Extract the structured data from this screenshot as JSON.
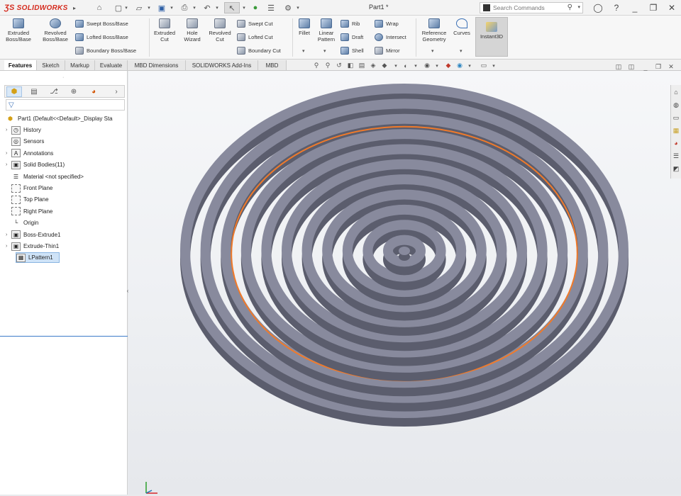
{
  "app": {
    "brand": "SOLIDWORKS",
    "document_title": "Part1 *",
    "search_placeholder": "Search Commands"
  },
  "ribbon": {
    "extrude_group": [
      {
        "label": "Extruded\nBoss/Base",
        "icon": "extruded-boss-icon"
      },
      {
        "label": "Revolved\nBoss/Base",
        "icon": "revolved-boss-icon"
      }
    ],
    "boss_small": [
      "Swept Boss/Base",
      "Lofted Boss/Base",
      "Boundary Boss/Base"
    ],
    "cut_group": [
      {
        "label": "Extruded\nCut",
        "icon": "extruded-cut-icon"
      },
      {
        "label": "Hole\nWizard",
        "icon": "hole-wizard-icon"
      },
      {
        "label": "Revolved\nCut",
        "icon": "revolved-cut-icon"
      }
    ],
    "cut_small": [
      "Swept Cut",
      "Lofted Cut",
      "Boundary Cut"
    ],
    "features": [
      {
        "label": "Fillet",
        "icon": "fillet-icon"
      },
      {
        "label": "Linear\nPattern",
        "icon": "linear-pattern-icon"
      }
    ],
    "features_small_a": [
      "Rib",
      "Draft",
      "Shell"
    ],
    "features_small_b": [
      "Wrap",
      "Intersect",
      "Mirror"
    ],
    "ref": [
      {
        "label": "Reference\nGeometry",
        "icon": "reference-geometry-icon"
      },
      {
        "label": "Curves",
        "icon": "curves-icon"
      },
      {
        "label": "Instant3D",
        "icon": "instant3d-icon"
      }
    ]
  },
  "tabs": [
    "Features",
    "Sketch",
    "Markup",
    "Evaluate",
    "MBD Dimensions",
    "SOLIDWORKS Add-Ins",
    "MBD"
  ],
  "active_tab": "Features",
  "tree": {
    "root": "Part1  (Default<<Default>_Display Sta",
    "items": [
      {
        "label": "History",
        "expandable": true,
        "icon": "history-icon"
      },
      {
        "label": "Sensors",
        "expandable": false,
        "icon": "sensors-icon"
      },
      {
        "label": "Annotations",
        "expandable": true,
        "icon": "annotations-icon"
      },
      {
        "label": "Solid Bodies(11)",
        "expandable": true,
        "icon": "solid-bodies-icon"
      },
      {
        "label": "Material <not specified>",
        "expandable": false,
        "icon": "material-icon"
      },
      {
        "label": "Front Plane",
        "expandable": false,
        "icon": "plane-icon"
      },
      {
        "label": "Top Plane",
        "expandable": false,
        "icon": "plane-icon"
      },
      {
        "label": "Right Plane",
        "expandable": false,
        "icon": "plane-icon"
      },
      {
        "label": "Origin",
        "expandable": false,
        "icon": "origin-icon"
      },
      {
        "label": "Boss-Extrude1",
        "expandable": true,
        "icon": "boss-extrude-icon"
      },
      {
        "label": "Extrude-Thin1",
        "expandable": true,
        "icon": "extrude-thin-icon"
      },
      {
        "label": "LPattern1",
        "expandable": false,
        "icon": "linear-pattern-icon",
        "selected": true
      }
    ]
  },
  "viewport": {
    "ring_count": 11,
    "highlight_ring_index": 8,
    "colors": {
      "ring_top": "#888a9d",
      "ring_side": "#5b5d6d",
      "highlight": "#f07a2a",
      "background": "#eef0f3"
    }
  }
}
